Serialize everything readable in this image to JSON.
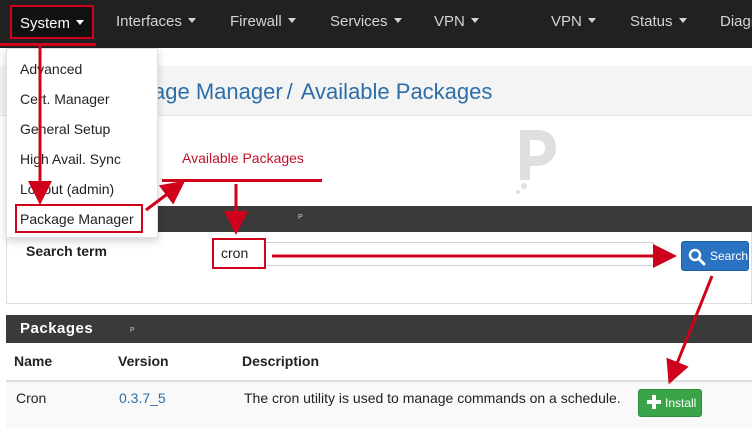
{
  "navbar": {
    "items": [
      {
        "label": "System",
        "dropdown": true
      },
      {
        "label": "Interfaces",
        "dropdown": true
      },
      {
        "label": "Firewall",
        "dropdown": true
      },
      {
        "label": "Services",
        "dropdown": true
      },
      {
        "label": "VPN",
        "dropdown": true
      },
      {
        "label": "VPN",
        "dropdown": true
      },
      {
        "label": "Status",
        "dropdown": true
      },
      {
        "label": "Diagi",
        "dropdown": false
      }
    ]
  },
  "system_menu": {
    "items": [
      "Advanced",
      "Cert. Manager",
      "General Setup",
      "High Avail. Sync",
      "Logout (admin)",
      "Package Manager"
    ]
  },
  "breadcrumb": {
    "parent": "kage Manager",
    "separator": "/",
    "current": "Available Packages"
  },
  "tabs": {
    "active": "Available Packages"
  },
  "search": {
    "label": "Search term",
    "value": "cron",
    "button": "Search"
  },
  "packages": {
    "title": "Packages",
    "columns": [
      "Name",
      "Version",
      "Description"
    ],
    "rows": [
      {
        "name": "Cron",
        "version": "0.3.7_5",
        "description": "The cron utility is used to manage commands on a schedule.",
        "action": "Install"
      }
    ]
  },
  "colors": {
    "accent_red": "#d0021b",
    "link_blue": "#2d6ea8",
    "search_blue": "#2a73c2",
    "install_green": "#3aa548",
    "navbar": "#212121"
  },
  "icons": [
    "caret-down-icon",
    "search-icon",
    "plus-icon",
    "watermark-logo"
  ]
}
